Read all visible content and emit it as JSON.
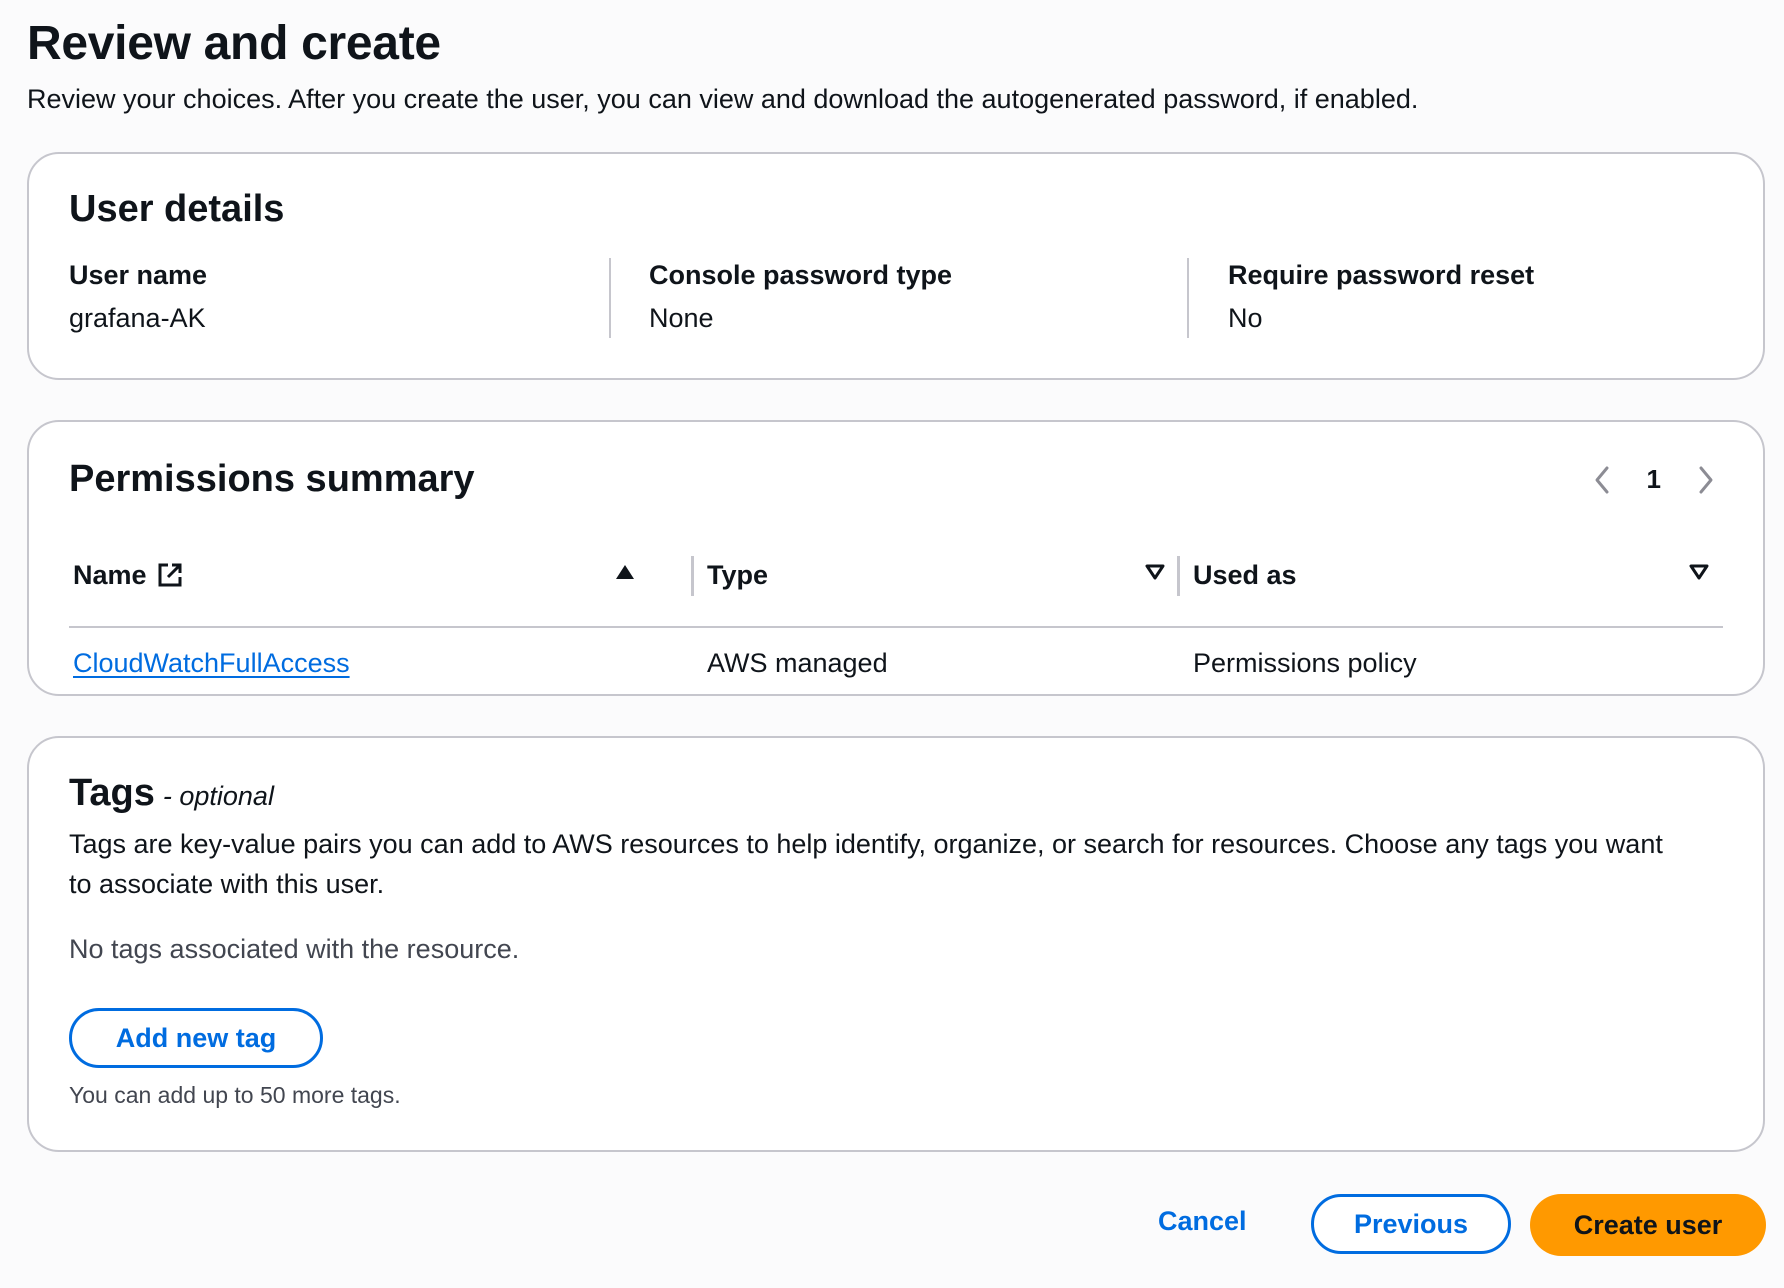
{
  "header": {
    "title": "Review and create",
    "description": "Review your choices. After you create the user, you can view and download the autogenerated password, if enabled."
  },
  "user_details": {
    "title": "User details",
    "fields": [
      {
        "label": "User name",
        "value": "grafana-AK"
      },
      {
        "label": "Console password type",
        "value": "None"
      },
      {
        "label": "Require password reset",
        "value": "No"
      }
    ]
  },
  "permissions": {
    "title": "Permissions summary",
    "page": "1",
    "columns": {
      "name": "Name",
      "type": "Type",
      "used_as": "Used as"
    },
    "rows": [
      {
        "name": "CloudWatchFullAccess",
        "type": "AWS managed",
        "used_as": "Permissions policy"
      }
    ]
  },
  "tags": {
    "title": "Tags",
    "optional": "- optional",
    "description": "Tags are key-value pairs you can add to AWS resources to help identify, organize, or search for resources. Choose any tags you want to associate with this user.",
    "empty": "No tags associated with the resource.",
    "add_button": "Add new tag",
    "hint": "You can add up to 50 more tags."
  },
  "actions": {
    "cancel": "Cancel",
    "previous": "Previous",
    "create": "Create user"
  },
  "colors": {
    "link": "#006ce0",
    "primary_button": "#ff9900",
    "border": "#c6c6cd"
  }
}
